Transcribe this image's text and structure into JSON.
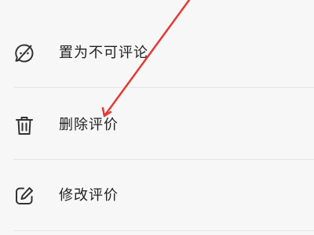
{
  "menu": {
    "items": [
      {
        "label": "置为不可评论",
        "icon": "comment-disabled-icon"
      },
      {
        "label": "删除评价",
        "icon": "trash-icon"
      },
      {
        "label": "修改评价",
        "icon": "edit-icon"
      }
    ]
  },
  "colors": {
    "background": "#f7f7f7",
    "text": "#222222",
    "icon": "#333333",
    "divider": "#e6e6e6",
    "annotation": "#e53935"
  }
}
